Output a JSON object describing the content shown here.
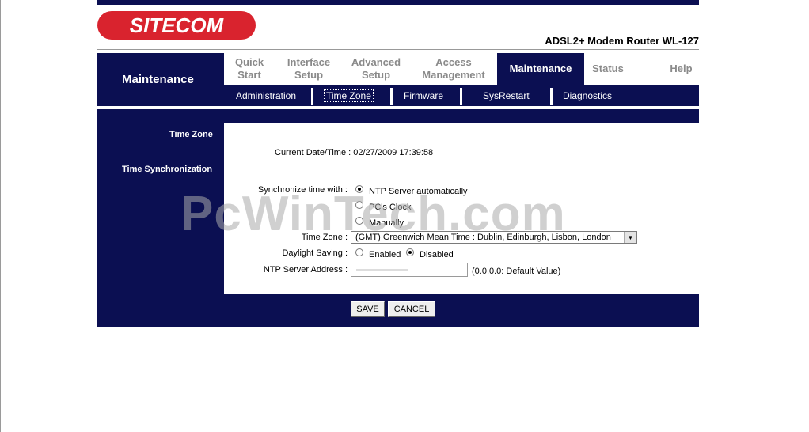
{
  "brand": {
    "logo_text": "SITECOM",
    "logo_color": "#d9232e",
    "product": "ADSL2+ Modem Router WL-127"
  },
  "section_title": "Maintenance",
  "nav": {
    "tabs": [
      {
        "label": "Quick Start",
        "active": false
      },
      {
        "label": "Interface Setup",
        "active": false
      },
      {
        "label": "Advanced Setup",
        "active": false
      },
      {
        "label": "Access Management",
        "active": false
      },
      {
        "label": "Maintenance",
        "active": true
      },
      {
        "label": "Status",
        "active": false
      },
      {
        "label": "Help",
        "active": false
      }
    ],
    "subtabs": [
      {
        "label": "Administration",
        "active": false
      },
      {
        "label": "Time Zone",
        "active": true
      },
      {
        "label": "Firmware",
        "active": false
      },
      {
        "label": "SysRestart",
        "active": false
      },
      {
        "label": "Diagnostics",
        "active": false
      }
    ]
  },
  "sidebar": {
    "time_zone_label": "Time Zone",
    "time_sync_label": "Time Synchronization"
  },
  "form": {
    "current_label": "Current Date/Time :",
    "current_value": "02/27/2009 17:39:58",
    "sync_label": "Synchronize time with :",
    "sync_options": [
      "NTP Server automatically",
      "PC's Clock",
      "Manually"
    ],
    "sync_selected": "NTP Server automatically",
    "timezone_label": "Time Zone :",
    "timezone_value": "(GMT) Greenwich Mean Time : Dublin, Edinburgh, Lisbon, London",
    "daylight_label": "Daylight Saving :",
    "daylight_options": [
      "Enabled",
      "Disabled"
    ],
    "daylight_selected": "Disabled",
    "ntp_label": "NTP Server Address :",
    "ntp_hint": "(0.0.0.0: Default Value)"
  },
  "buttons": {
    "save": "SAVE",
    "cancel": "CANCEL"
  },
  "watermark": "PcWinTech.com",
  "colors": {
    "navy": "#0b0f52",
    "inactive_tab": "#8a8a8a"
  }
}
